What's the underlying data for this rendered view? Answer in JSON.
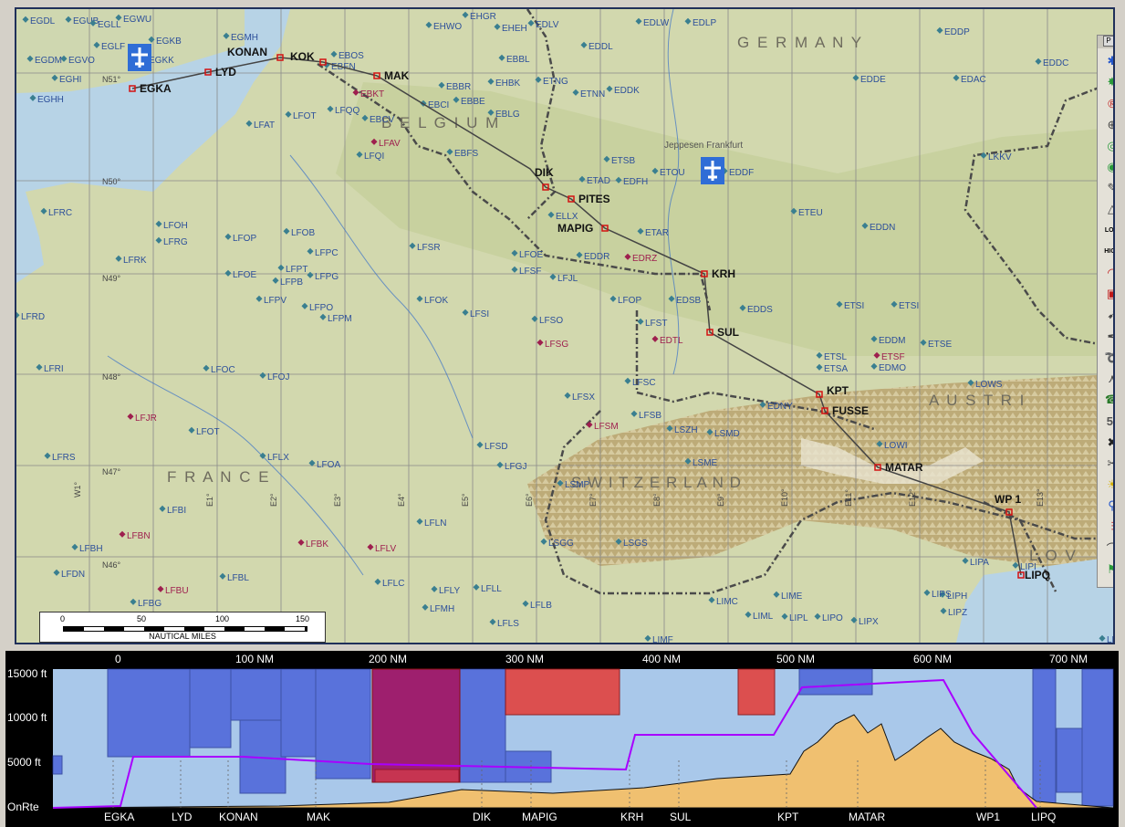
{
  "map": {
    "countries": [
      {
        "name": "G E R M A N Y"
      },
      {
        "name": "B E L G I U M"
      },
      {
        "name": "F R A N C E"
      },
      {
        "name": "S W I T Z E R L A N D"
      },
      {
        "name": "A U S T R I"
      },
      {
        "name": "L O V"
      }
    ],
    "provider_label": "Jeppesen Frankfurt",
    "lat_labels": [
      "N51°",
      "N50°",
      "N49°",
      "N48°",
      "N47°",
      "N46°"
    ],
    "lon_labels": [
      "W1°",
      "E1°",
      "E2°",
      "E3°",
      "E4°",
      "E5°",
      "E6°",
      "E7°",
      "E8°",
      "E9°",
      "E10°",
      "E11°",
      "E12°",
      "E13°"
    ],
    "airports": [
      {
        "id": "EGDL"
      },
      {
        "id": "EGUB"
      },
      {
        "id": "EGLL"
      },
      {
        "id": "EGWU"
      },
      {
        "id": "EGLF"
      },
      {
        "id": "EGKB"
      },
      {
        "id": "EGKK"
      },
      {
        "id": "EGDM"
      },
      {
        "id": "EGVO"
      },
      {
        "id": "EGHI"
      },
      {
        "id": "EGHH"
      },
      {
        "id": "EGMH"
      },
      {
        "id": "EHWO"
      },
      {
        "id": "EHGR"
      },
      {
        "id": "EHEH"
      },
      {
        "id": "EDLV"
      },
      {
        "id": "EDLW"
      },
      {
        "id": "EDLP"
      },
      {
        "id": "EDDL"
      },
      {
        "id": "EDDP"
      },
      {
        "id": "EBOS"
      },
      {
        "id": "EBFN"
      },
      {
        "id": "EBBR"
      },
      {
        "id": "EHBK"
      },
      {
        "id": "ETNG"
      },
      {
        "id": "EBBL"
      },
      {
        "id": "EDDE"
      },
      {
        "id": "EDAC"
      },
      {
        "id": "EDDC"
      },
      {
        "id": "EBKT"
      },
      {
        "id": "EBCI"
      },
      {
        "id": "EBBE"
      },
      {
        "id": "ETNN"
      },
      {
        "id": "EDDK"
      },
      {
        "id": "LFQQ"
      },
      {
        "id": "EBCV"
      },
      {
        "id": "EBLG"
      },
      {
        "id": "LFOT"
      },
      {
        "id": "LFAT"
      },
      {
        "id": "LFAV"
      },
      {
        "id": "LFQI"
      },
      {
        "id": "EBFS"
      },
      {
        "id": "ETSB"
      },
      {
        "id": "ETOU"
      },
      {
        "id": "EDDF"
      },
      {
        "id": "LKKV"
      },
      {
        "id": "ETAD"
      },
      {
        "id": "EDFH"
      },
      {
        "id": "ELLX"
      },
      {
        "id": "ETEU"
      },
      {
        "id": "EDDN"
      },
      {
        "id": "ETAR"
      },
      {
        "id": "EDRZ"
      },
      {
        "id": "EDDR"
      },
      {
        "id": "LFRC"
      },
      {
        "id": "LFOH"
      },
      {
        "id": "LFRG"
      },
      {
        "id": "LFOB"
      },
      {
        "id": "LFOP"
      },
      {
        "id": "LFSR"
      },
      {
        "id": "LFOE"
      },
      {
        "id": "LFSF"
      },
      {
        "id": "LFJL"
      },
      {
        "id": "LFRK"
      },
      {
        "id": "LFPC"
      },
      {
        "id": "LFPT"
      },
      {
        "id": "LFPB"
      },
      {
        "id": "LFPG"
      },
      {
        "id": "LFOE"
      },
      {
        "id": "LFOK"
      },
      {
        "id": "LFOP"
      },
      {
        "id": "EDSB"
      },
      {
        "id": "EDDS"
      },
      {
        "id": "ETSI"
      },
      {
        "id": "ETSI"
      },
      {
        "id": "LFRD"
      },
      {
        "id": "LFPV"
      },
      {
        "id": "LFPO"
      },
      {
        "id": "LFPM"
      },
      {
        "id": "LFSI"
      },
      {
        "id": "LFSO"
      },
      {
        "id": "LFST"
      },
      {
        "id": "EDTL"
      },
      {
        "id": "EDDM"
      },
      {
        "id": "ETSE"
      },
      {
        "id": "LFSG"
      },
      {
        "id": "ETSF"
      },
      {
        "id": "ETSL"
      },
      {
        "id": "ETSA"
      },
      {
        "id": "EDMO"
      },
      {
        "id": "LFRI"
      },
      {
        "id": "LFOC"
      },
      {
        "id": "LFOJ"
      },
      {
        "id": "LFSC"
      },
      {
        "id": "LOWS"
      },
      {
        "id": "LFSX"
      },
      {
        "id": "EDNY"
      },
      {
        "id": "LFJR"
      },
      {
        "id": "LFOT"
      },
      {
        "id": "LFSB"
      },
      {
        "id": "LFSM"
      },
      {
        "id": "LSZH"
      },
      {
        "id": "LSMD"
      },
      {
        "id": "LOWI"
      },
      {
        "id": "LFSD"
      },
      {
        "id": "LFRS"
      },
      {
        "id": "LFLX"
      },
      {
        "id": "LFOA"
      },
      {
        "id": "LFGJ"
      },
      {
        "id": "LSME"
      },
      {
        "id": "LSMP"
      },
      {
        "id": "LFBI"
      },
      {
        "id": "LFLN"
      },
      {
        "id": "LFBN"
      },
      {
        "id": "LFBK"
      },
      {
        "id": "LFLV"
      },
      {
        "id": "LSGG"
      },
      {
        "id": "LSGS"
      },
      {
        "id": "LFBH"
      },
      {
        "id": "LFDN"
      },
      {
        "id": "LFBL"
      },
      {
        "id": "LFLC"
      },
      {
        "id": "LFLY"
      },
      {
        "id": "LFLL"
      },
      {
        "id": "LFLB"
      },
      {
        "id": "LFBU"
      },
      {
        "id": "LFBG"
      },
      {
        "id": "LFMH"
      },
      {
        "id": "LFLS"
      },
      {
        "id": "LIPA"
      },
      {
        "id": "LIPI"
      },
      {
        "id": "LIPH"
      },
      {
        "id": "LIPS"
      },
      {
        "id": "LIME"
      },
      {
        "id": "LIMC"
      },
      {
        "id": "LIML"
      },
      {
        "id": "LIPL"
      },
      {
        "id": "LIPO"
      },
      {
        "id": "LIPX"
      },
      {
        "id": "LIPZ"
      },
      {
        "id": "LIMF"
      },
      {
        "id": "LDR"
      }
    ],
    "route": {
      "waypoints": [
        "EGKA",
        "LYD",
        "KONAN",
        "KOK",
        "MAK",
        "DIK",
        "PITES",
        "MAPIG",
        "KRH",
        "SUL",
        "KPT",
        "FUSSE",
        "MATAR",
        "WP 1",
        "LIPQ"
      ]
    },
    "scale_bar": {
      "ticks": [
        "0",
        "50",
        "100",
        "150"
      ],
      "caption": "NAUTICAL MILES"
    }
  },
  "toolbar": {
    "header_buttons": [
      "P",
      "X"
    ],
    "tools": [
      "settings-icon",
      "gear-green-icon",
      "r-circle-icon",
      "target-icon",
      "green-target-icon",
      "green-circle-icon",
      "pen-icon",
      "triangle-icon",
      "low-icon",
      "high-icon",
      "arc-icon",
      "r-box-icon",
      "pointer-icon",
      "feather-icon",
      "lasso-icon",
      "tripod-icon",
      "phone-icon",
      "s1-icon",
      "delete-icon",
      "wrench-icon",
      "sun-icon",
      "satellite-icon",
      "chart-icon",
      "curve-icon",
      "flag-icon"
    ],
    "text_labels": [
      "LOW",
      "HIGH",
      "5₁"
    ]
  },
  "profile": {
    "y_labels": [
      "15000 ft",
      "10000 ft",
      "5000 ft",
      "OnRte"
    ],
    "x_labels": [
      "0",
      "100 NM",
      "200 NM",
      "300 NM",
      "400 NM",
      "500 NM",
      "600 NM",
      "700 NM"
    ],
    "waypoint_labels": [
      "EGKA",
      "LYD",
      "KONAN",
      "MAK",
      "DIK",
      "MAPIG",
      "KRH",
      "SUL",
      "KPT",
      "MATAR",
      "WP1",
      "LIPQ"
    ],
    "colors": {
      "background": "#a9c8ea",
      "airspace": "#3f56d6",
      "restricted": "#e2433f",
      "route": "#a800ff",
      "terrain": "#f0c070"
    }
  }
}
